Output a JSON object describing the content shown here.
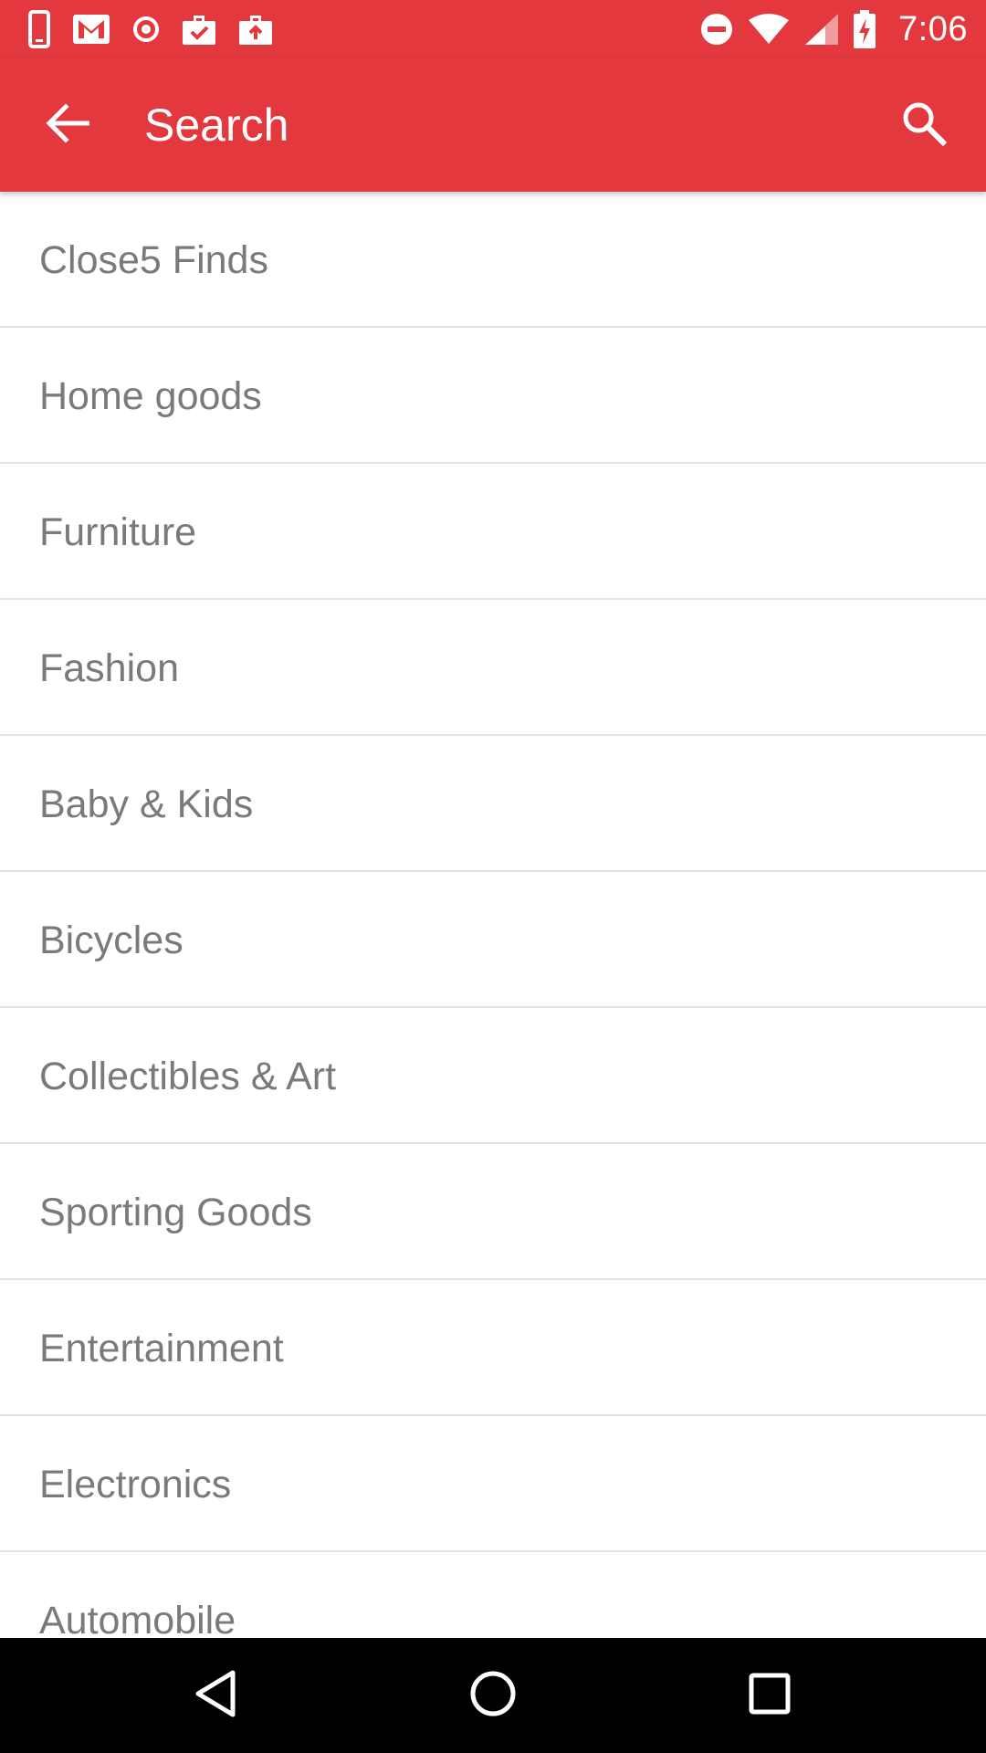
{
  "colors": {
    "brand": "#e2383e",
    "list_text": "#7a7a7a",
    "divider": "#e3e3e3",
    "nav_bar": "#000000"
  },
  "status_bar": {
    "time": "7:06",
    "left_icons": [
      "phone-icon",
      "gmail-icon",
      "record-icon",
      "work-check-icon",
      "work-upload-icon"
    ],
    "right_icons": [
      "do-not-disturb-icon",
      "wifi-icon",
      "cell-signal-icon",
      "battery-charging-icon"
    ]
  },
  "app_bar": {
    "title": "Search",
    "back_icon": "arrow-back-icon",
    "search_icon": "search-icon"
  },
  "categories": [
    {
      "label": "Close5 Finds"
    },
    {
      "label": "Home goods"
    },
    {
      "label": "Furniture"
    },
    {
      "label": "Fashion"
    },
    {
      "label": "Baby & Kids"
    },
    {
      "label": "Bicycles"
    },
    {
      "label": "Collectibles & Art"
    },
    {
      "label": "Sporting Goods"
    },
    {
      "label": "Entertainment"
    },
    {
      "label": "Electronics"
    },
    {
      "label": "Automobile"
    }
  ],
  "nav_bar": {
    "icons": [
      "nav-back-icon",
      "nav-home-icon",
      "nav-recents-icon"
    ]
  }
}
